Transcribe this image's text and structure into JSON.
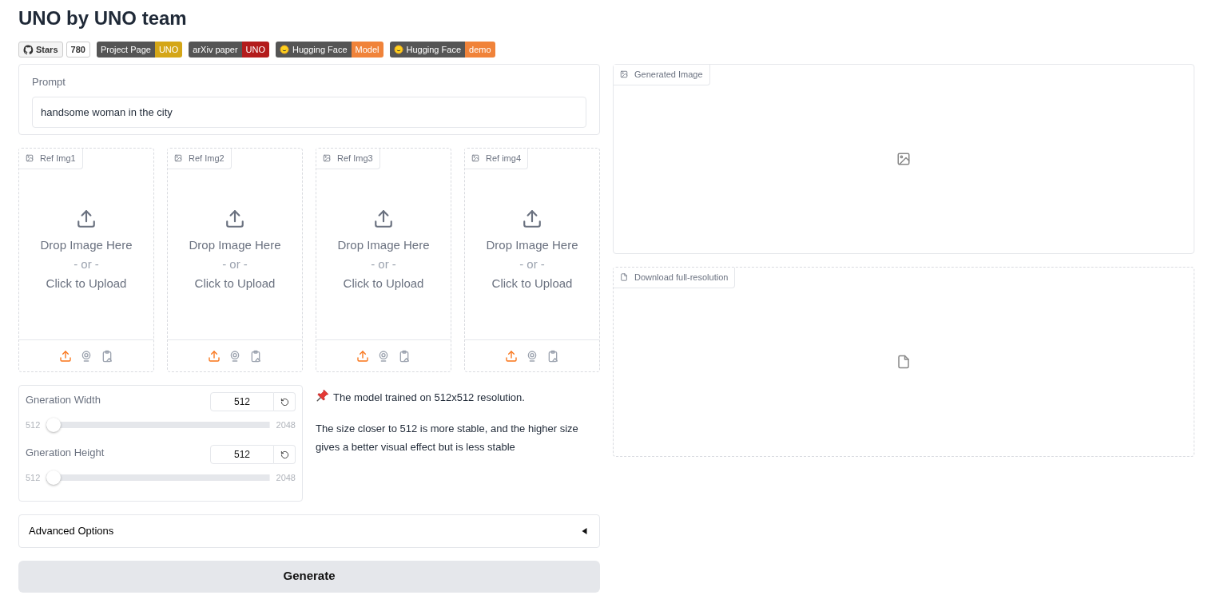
{
  "title": "UNO by UNO team",
  "badges": [
    {
      "kind": "github",
      "label": "Stars",
      "value": "780"
    },
    {
      "kind": "shield",
      "label": "Project Page",
      "value": "UNO",
      "color": "#d4a618"
    },
    {
      "kind": "shield",
      "label": "arXiv paper",
      "value": "UNO",
      "color": "#b31b1b"
    },
    {
      "kind": "hf",
      "label": "Hugging Face",
      "value": "Model",
      "color": "#f0833a"
    },
    {
      "kind": "hf",
      "label": "Hugging Face",
      "value": "demo",
      "color": "#f0833a"
    }
  ],
  "prompt": {
    "label": "Prompt",
    "value": "handsome woman in the city"
  },
  "ref_images": [
    {
      "label": "Ref Img1",
      "drop": "Drop Image Here",
      "or": "- or -",
      "click": "Click to Upload"
    },
    {
      "label": "Ref Img2",
      "drop": "Drop Image Here",
      "or": "- or -",
      "click": "Click to Upload"
    },
    {
      "label": "Ref Img3",
      "drop": "Drop Image Here",
      "or": "- or -",
      "click": "Click to Upload"
    },
    {
      "label": "Ref img4",
      "drop": "Drop Image Here",
      "or": "- or -",
      "click": "Click to Upload"
    }
  ],
  "sliders": [
    {
      "label": "Gneration Width",
      "value": "512",
      "min": "512",
      "max": "2048",
      "level": 0
    },
    {
      "label": "Gneration Height",
      "value": "512",
      "min": "512",
      "max": "2048",
      "level": 0
    }
  ],
  "notes": [
    {
      "kind": "pin",
      "text": "The model trained on 512x512 resolution."
    },
    {
      "kind": "plain",
      "text": "The size closer to 512 is more stable, and the higher size gives a better visual effect but is less stable"
    }
  ],
  "advanced": {
    "label": "Advanced Options",
    "expanded": false
  },
  "generate_button": "Generate",
  "output_image": {
    "label": "Generated Image"
  },
  "download": {
    "label": "Download full-resolution"
  }
}
